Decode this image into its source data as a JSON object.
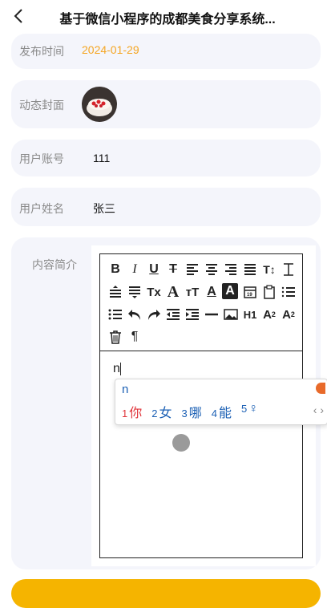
{
  "nav": {
    "title": "基于微信小程序的成都美食分享系统..."
  },
  "form": {
    "publish_time_label": "发布时间",
    "publish_time_value": "2024-01-29",
    "cover_label": "动态封面",
    "account_label": "用户账号",
    "account_value": "111",
    "name_label": "用户姓名",
    "name_value": "张三",
    "content_label": "内容简介"
  },
  "editor": {
    "typed_text": "n",
    "toolbar_icons": [
      "bold-icon",
      "italic-icon",
      "underline-icon",
      "strikethrough-icon",
      "align-left-icon",
      "align-center-icon",
      "align-right-icon",
      "align-justify-icon",
      "font-size-icon",
      "line-height-icon",
      "paragraph-spacing-before-icon",
      "paragraph-spacing-after-icon",
      "clear-format-icon",
      "font-family-icon",
      "font-size-larger-icon",
      "font-color-icon",
      "background-color-icon",
      "date-icon",
      "clipboard-icon",
      "ordered-list-icon",
      "unordered-list-icon",
      "undo-icon",
      "redo-icon",
      "outdent-icon",
      "indent-icon",
      "horizontal-rule-icon",
      "image-icon",
      "heading-icon",
      "subscript-icon",
      "superscript-icon",
      "delete-icon",
      "paragraph-mark-icon"
    ]
  },
  "ime": {
    "input": "n",
    "candidates": [
      {
        "num": "1",
        "text": "你"
      },
      {
        "num": "2",
        "text": "女"
      },
      {
        "num": "3",
        "text": "哪"
      },
      {
        "num": "4",
        "text": "能"
      },
      {
        "num": "5",
        "text": "♀"
      }
    ]
  },
  "colors": {
    "date": "#f5a623",
    "row_bg": "#f4f5fb",
    "submit": "#f5b400"
  }
}
